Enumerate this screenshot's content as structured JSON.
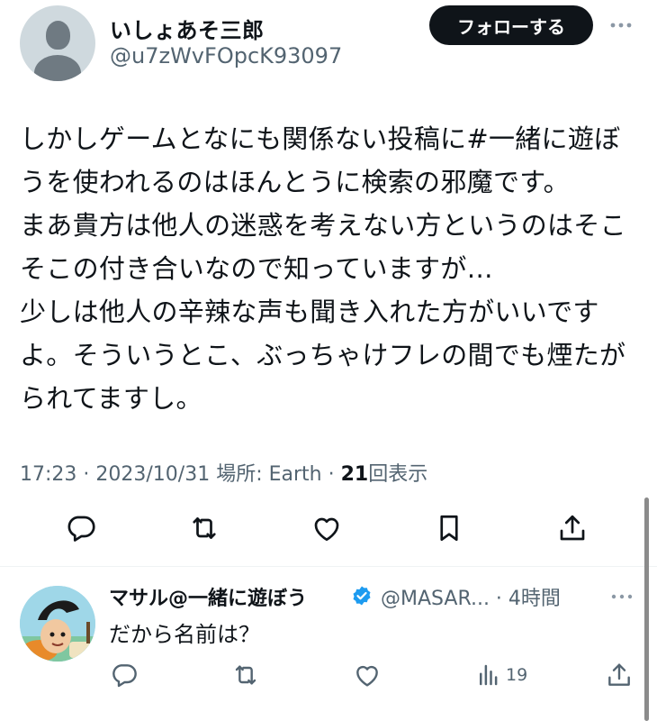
{
  "tweet": {
    "author": {
      "display_name": "いしょあそ三郎",
      "handle": "@u7zWvFOpcK93097",
      "avatar_icon": "default-profile-icon"
    },
    "follow_label": "フォローする",
    "text": "しかしゲームとなにも関係ない投稿に#一緒に遊ぼ\nうを使われるのはほんとうに検索の邪魔です。\nまあ貴方は他人の迷惑を考えない方というのはそこ\nそこの付き合いなので知っていますが…\n少しは他人の辛辣な声も聞き入れた方がいいです\nよ。そういうとこ、ぶっちゃけフレの間でも煙たが\nられてますし。",
    "meta": {
      "time": "17:23",
      "sep1": " · ",
      "date": "2023/10/31",
      "location": " 場所: Earth",
      "sep2": " · ",
      "views_count": "21",
      "views_label": "回表示"
    },
    "actions": [
      "reply-icon",
      "retweet-icon",
      "like-icon",
      "bookmark-icon",
      "share-icon"
    ]
  },
  "reply": {
    "display_name": "マサル@一緒に遊ぼう",
    "verified": true,
    "handle": "@MASAR... · 4時間",
    "text": "だから名前は？",
    "views_count": "19",
    "actions": [
      "reply-icon",
      "retweet-icon",
      "like-icon",
      "views-icon",
      "share-icon"
    ]
  },
  "colors": {
    "text": "#0f1419",
    "secondary": "#536471",
    "follow_bg": "#0f1419",
    "verified": "#1d9bf0",
    "divider": "#eff3f4"
  }
}
